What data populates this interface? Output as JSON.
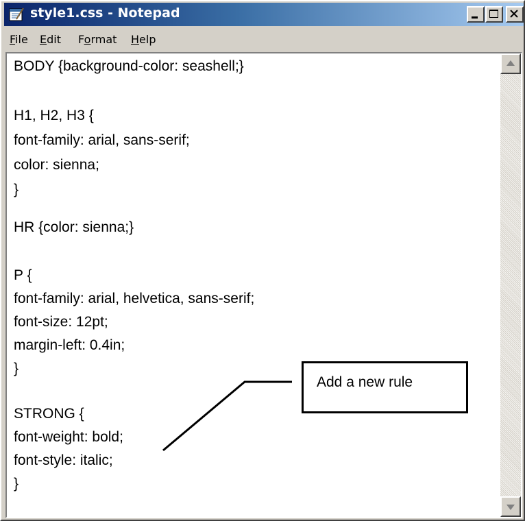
{
  "window": {
    "title": "style1.css - Notepad",
    "controls": {
      "minimize": "minimize-button",
      "maximize": "maximize-button",
      "close": "close-button"
    }
  },
  "menu": {
    "file": {
      "accel": "F",
      "rest": "ile"
    },
    "edit": {
      "accel": "E",
      "rest": "dit"
    },
    "format": {
      "pre": "F",
      "accel": "o",
      "rest": "rmat"
    },
    "help": {
      "accel": "H",
      "rest": "elp"
    }
  },
  "editor": {
    "lines": [
      "BODY {background-color: seashell;}",
      "",
      "H1, H2, H3 {",
      "font-family: arial, sans-serif;",
      "color: sienna;",
      "}",
      "",
      "HR {color: sienna;}",
      "",
      "P {",
      "font-family: arial, helvetica, sans-serif;",
      "font-size: 12pt;",
      "margin-left: 0.4in;",
      "}",
      "",
      "STRONG {",
      "font-weight: bold;",
      "font-style: italic;",
      "}"
    ]
  },
  "callout": {
    "text": "Add a new rule"
  },
  "colors": {
    "titlebar_start": "#0a246a",
    "titlebar_end": "#a6caf0",
    "chrome": "#d4d0c8"
  }
}
